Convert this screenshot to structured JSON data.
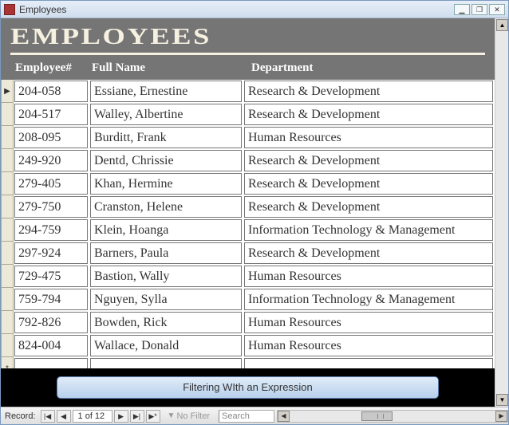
{
  "window": {
    "title": "Employees",
    "minimize": "▁",
    "restore": "❐",
    "close": "✕"
  },
  "header": {
    "title": "Employees"
  },
  "columns": {
    "c1": "Employee#",
    "c2": "Full Name",
    "c3": "Department"
  },
  "rows": [
    {
      "marker": "▶",
      "emp": "204-058",
      "name": "Essiane, Ernestine",
      "dept": "Research & Development"
    },
    {
      "marker": "",
      "emp": "204-517",
      "name": "Walley, Albertine",
      "dept": "Research & Development"
    },
    {
      "marker": "",
      "emp": "208-095",
      "name": "Burditt, Frank",
      "dept": "Human Resources"
    },
    {
      "marker": "",
      "emp": "249-920",
      "name": "Dentd, Chrissie",
      "dept": "Research & Development"
    },
    {
      "marker": "",
      "emp": "279-405",
      "name": "Khan, Hermine",
      "dept": "Research & Development"
    },
    {
      "marker": "",
      "emp": "279-750",
      "name": "Cranston, Helene",
      "dept": "Research & Development"
    },
    {
      "marker": "",
      "emp": "294-759",
      "name": "Klein, Hoanga",
      "dept": "Information Technology & Management"
    },
    {
      "marker": "",
      "emp": "297-924",
      "name": "Barners, Paula",
      "dept": "Research & Development"
    },
    {
      "marker": "",
      "emp": "729-475",
      "name": "Bastion, Wally",
      "dept": "Human Resources"
    },
    {
      "marker": "",
      "emp": "759-794",
      "name": "Nguyen, Sylla",
      "dept": "Information Technology & Management"
    },
    {
      "marker": "",
      "emp": "792-826",
      "name": "Bowden, Rick",
      "dept": "Human Resources"
    },
    {
      "marker": "",
      "emp": "824-004",
      "name": "Wallace, Donald",
      "dept": "Human Resources"
    },
    {
      "marker": "*",
      "emp": "",
      "name": "",
      "dept": ""
    }
  ],
  "footer": {
    "button_label": "Filtering WIth an Expression"
  },
  "statusbar": {
    "record_label": "Record:",
    "position": "1 of 12",
    "nav_first": "|◀",
    "nav_prev": "◀",
    "nav_next": "▶",
    "nav_last": "▶|",
    "nav_new": "▶*",
    "filter_label": "No Filter",
    "search_placeholder": "Search",
    "scroll_left": "◀",
    "scroll_right": "▶",
    "scroll_up": "▲",
    "scroll_down": "▼"
  }
}
